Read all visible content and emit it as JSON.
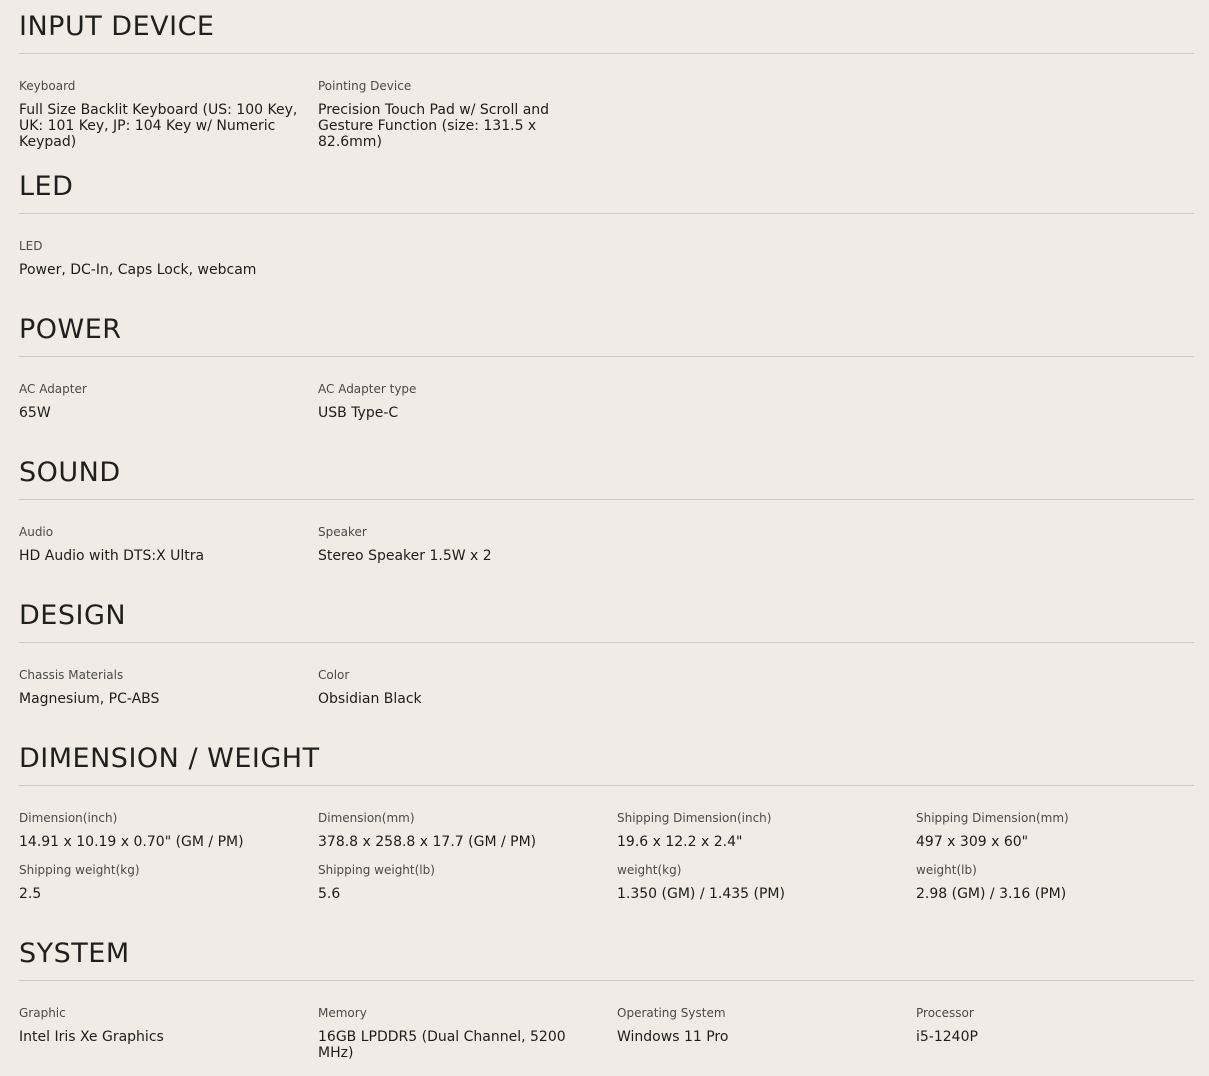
{
  "sections": {
    "input_device": {
      "title": "INPUT DEVICE",
      "specs": [
        {
          "label": "Keyboard",
          "value": "Full Size Backlit Keyboard (US: 100 Key, UK: 101 Key, JP: 104 Key w/ Numeric Keypad)"
        },
        {
          "label": "Pointing Device",
          "value": "Precision Touch Pad w/ Scroll and Gesture Function (size: 131.5 x 82.6mm)"
        }
      ]
    },
    "led": {
      "title": "LED",
      "specs": [
        {
          "label": "LED",
          "value": "Power, DC-In, Caps Lock, webcam"
        }
      ]
    },
    "power": {
      "title": "POWER",
      "specs": [
        {
          "label": "AC Adapter",
          "value": "65W"
        },
        {
          "label": "AC Adapter type",
          "value": "USB Type-C"
        }
      ]
    },
    "sound": {
      "title": "SOUND",
      "specs": [
        {
          "label": "Audio",
          "value": "HD Audio with DTS:X Ultra"
        },
        {
          "label": "Speaker",
          "value": "Stereo Speaker 1.5W x 2"
        }
      ]
    },
    "design": {
      "title": "DESIGN",
      "specs": [
        {
          "label": "Chassis Materials",
          "value": "Magnesium, PC-ABS"
        },
        {
          "label": "Color",
          "value": "Obsidian Black"
        }
      ]
    },
    "dimension": {
      "title": "DIMENSION / WEIGHT",
      "specs": [
        {
          "label": "Dimension(inch)",
          "value": "14.91 x 10.19 x 0.70\" (GM / PM)"
        },
        {
          "label": "Dimension(mm)",
          "value": "378.8 x 258.8 x 17.7 (GM / PM)"
        },
        {
          "label": "Shipping Dimension(inch)",
          "value": "19.6 x 12.2 x 2.4\""
        },
        {
          "label": "Shipping Dimension(mm)",
          "value": "497 x 309 x 60\""
        },
        {
          "label": "Shipping weight(kg)",
          "value": "2.5"
        },
        {
          "label": "Shipping weight(lb)",
          "value": "5.6"
        },
        {
          "label": "weight(kg)",
          "value": "1.350 (GM) / 1.435 (PM)"
        },
        {
          "label": "weight(lb)",
          "value": "2.98 (GM) / 3.16 (PM)"
        }
      ]
    },
    "system": {
      "title": "SYSTEM",
      "specs": [
        {
          "label": "Graphic",
          "value": "Intel Iris Xe Graphics"
        },
        {
          "label": "Memory",
          "value": "16GB LPDDR5 (Dual Channel, 5200 MHz)"
        },
        {
          "label": "Operating System",
          "value": "Windows 11 Pro"
        },
        {
          "label": "Processor",
          "value": "i5-1240P"
        }
      ]
    }
  }
}
